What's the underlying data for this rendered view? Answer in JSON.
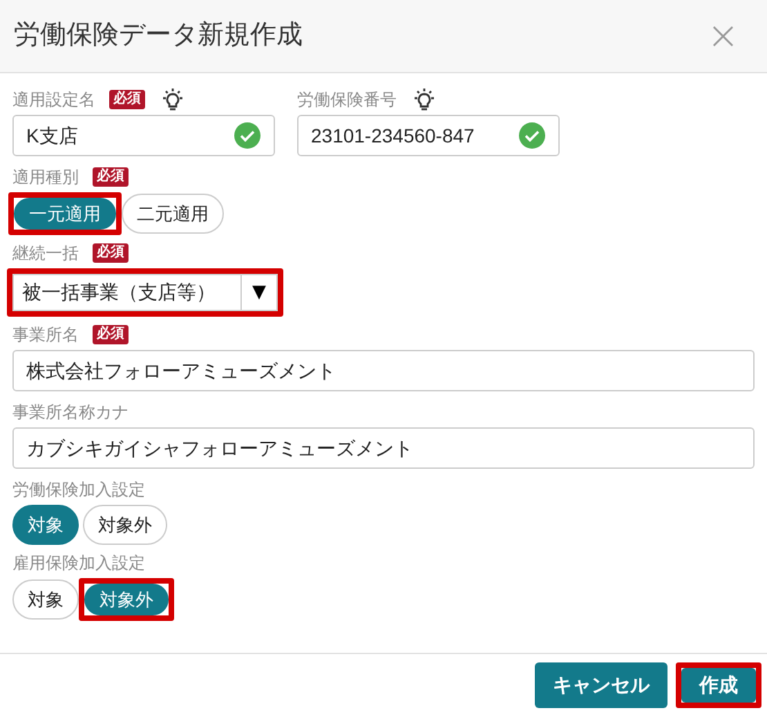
{
  "dialog": {
    "title": "労働保険データ新規作成",
    "close": "×"
  },
  "top_fields": [
    {
      "kind": "text",
      "label": "適用設定名",
      "badge": "必須",
      "hint": true,
      "value": "K支店",
      "valid": true
    },
    {
      "kind": "text",
      "label": "労働保険番号",
      "hint": true,
      "value": "23101-234560-847",
      "valid": true
    }
  ],
  "fields": [
    {
      "kind": "toggle",
      "label": "適用種別",
      "badge": "必須",
      "options": [
        {
          "label": "一元適用",
          "selected": true,
          "highlighted": true
        },
        {
          "label": "二元適用",
          "selected": false,
          "highlighted": false
        }
      ]
    },
    {
      "kind": "select",
      "label": "継続一括",
      "badge": "必須",
      "value": "被一括事業（支店等）",
      "caret": "▼",
      "highlighted": true
    },
    {
      "kind": "text",
      "label": "事業所名",
      "badge": "必須",
      "value": "株式会社フォローアミューズメント"
    },
    {
      "kind": "text",
      "label": "事業所名称カナ",
      "value": "カブシキガイシャフォローアミューズメント"
    },
    {
      "kind": "toggle",
      "label": "労働保険加入設定",
      "options": [
        {
          "label": "対象",
          "selected": true,
          "highlighted": false
        },
        {
          "label": "対象外",
          "selected": false,
          "highlighted": false
        }
      ]
    },
    {
      "kind": "toggle",
      "label": "雇用保険加入設定",
      "options": [
        {
          "label": "対象",
          "selected": false,
          "highlighted": false
        },
        {
          "label": "対象外",
          "selected": true,
          "highlighted": true
        }
      ]
    }
  ],
  "buttons": [
    {
      "label": "キャンセル",
      "highlighted": false
    },
    {
      "label": "作成",
      "highlighted": true
    }
  ]
}
